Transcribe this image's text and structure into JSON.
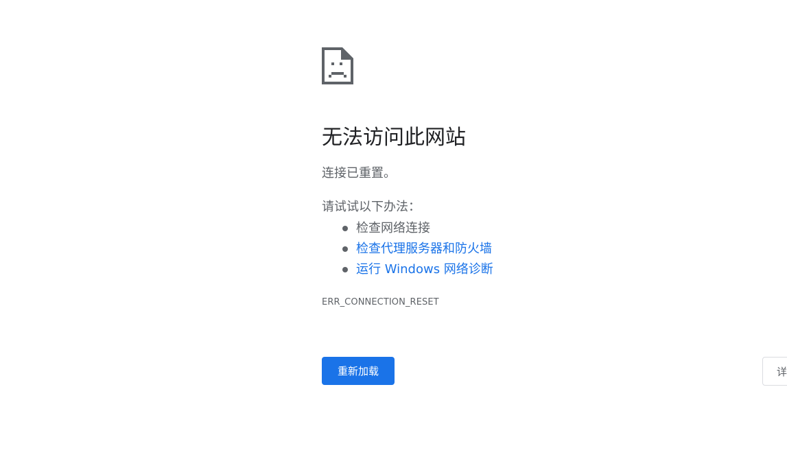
{
  "error": {
    "icon": "sad-document-icon",
    "title": "无法访问此网站",
    "description": "连接已重置。",
    "suggestions_heading": "请试试以下办法：",
    "suggestions": [
      {
        "label": "检查网络连接",
        "link": false
      },
      {
        "label": "检查代理服务器和防火墙",
        "link": true
      },
      {
        "label": "运行 Windows 网络诊断",
        "link": true
      }
    ],
    "code": "ERR_CONNECTION_RESET"
  },
  "buttons": {
    "reload_label": "重新加载",
    "details_label": "详"
  },
  "colors": {
    "primary": "#1a73e8",
    "text": "#5f6368",
    "title": "#202124",
    "icon": "#5f6368"
  }
}
